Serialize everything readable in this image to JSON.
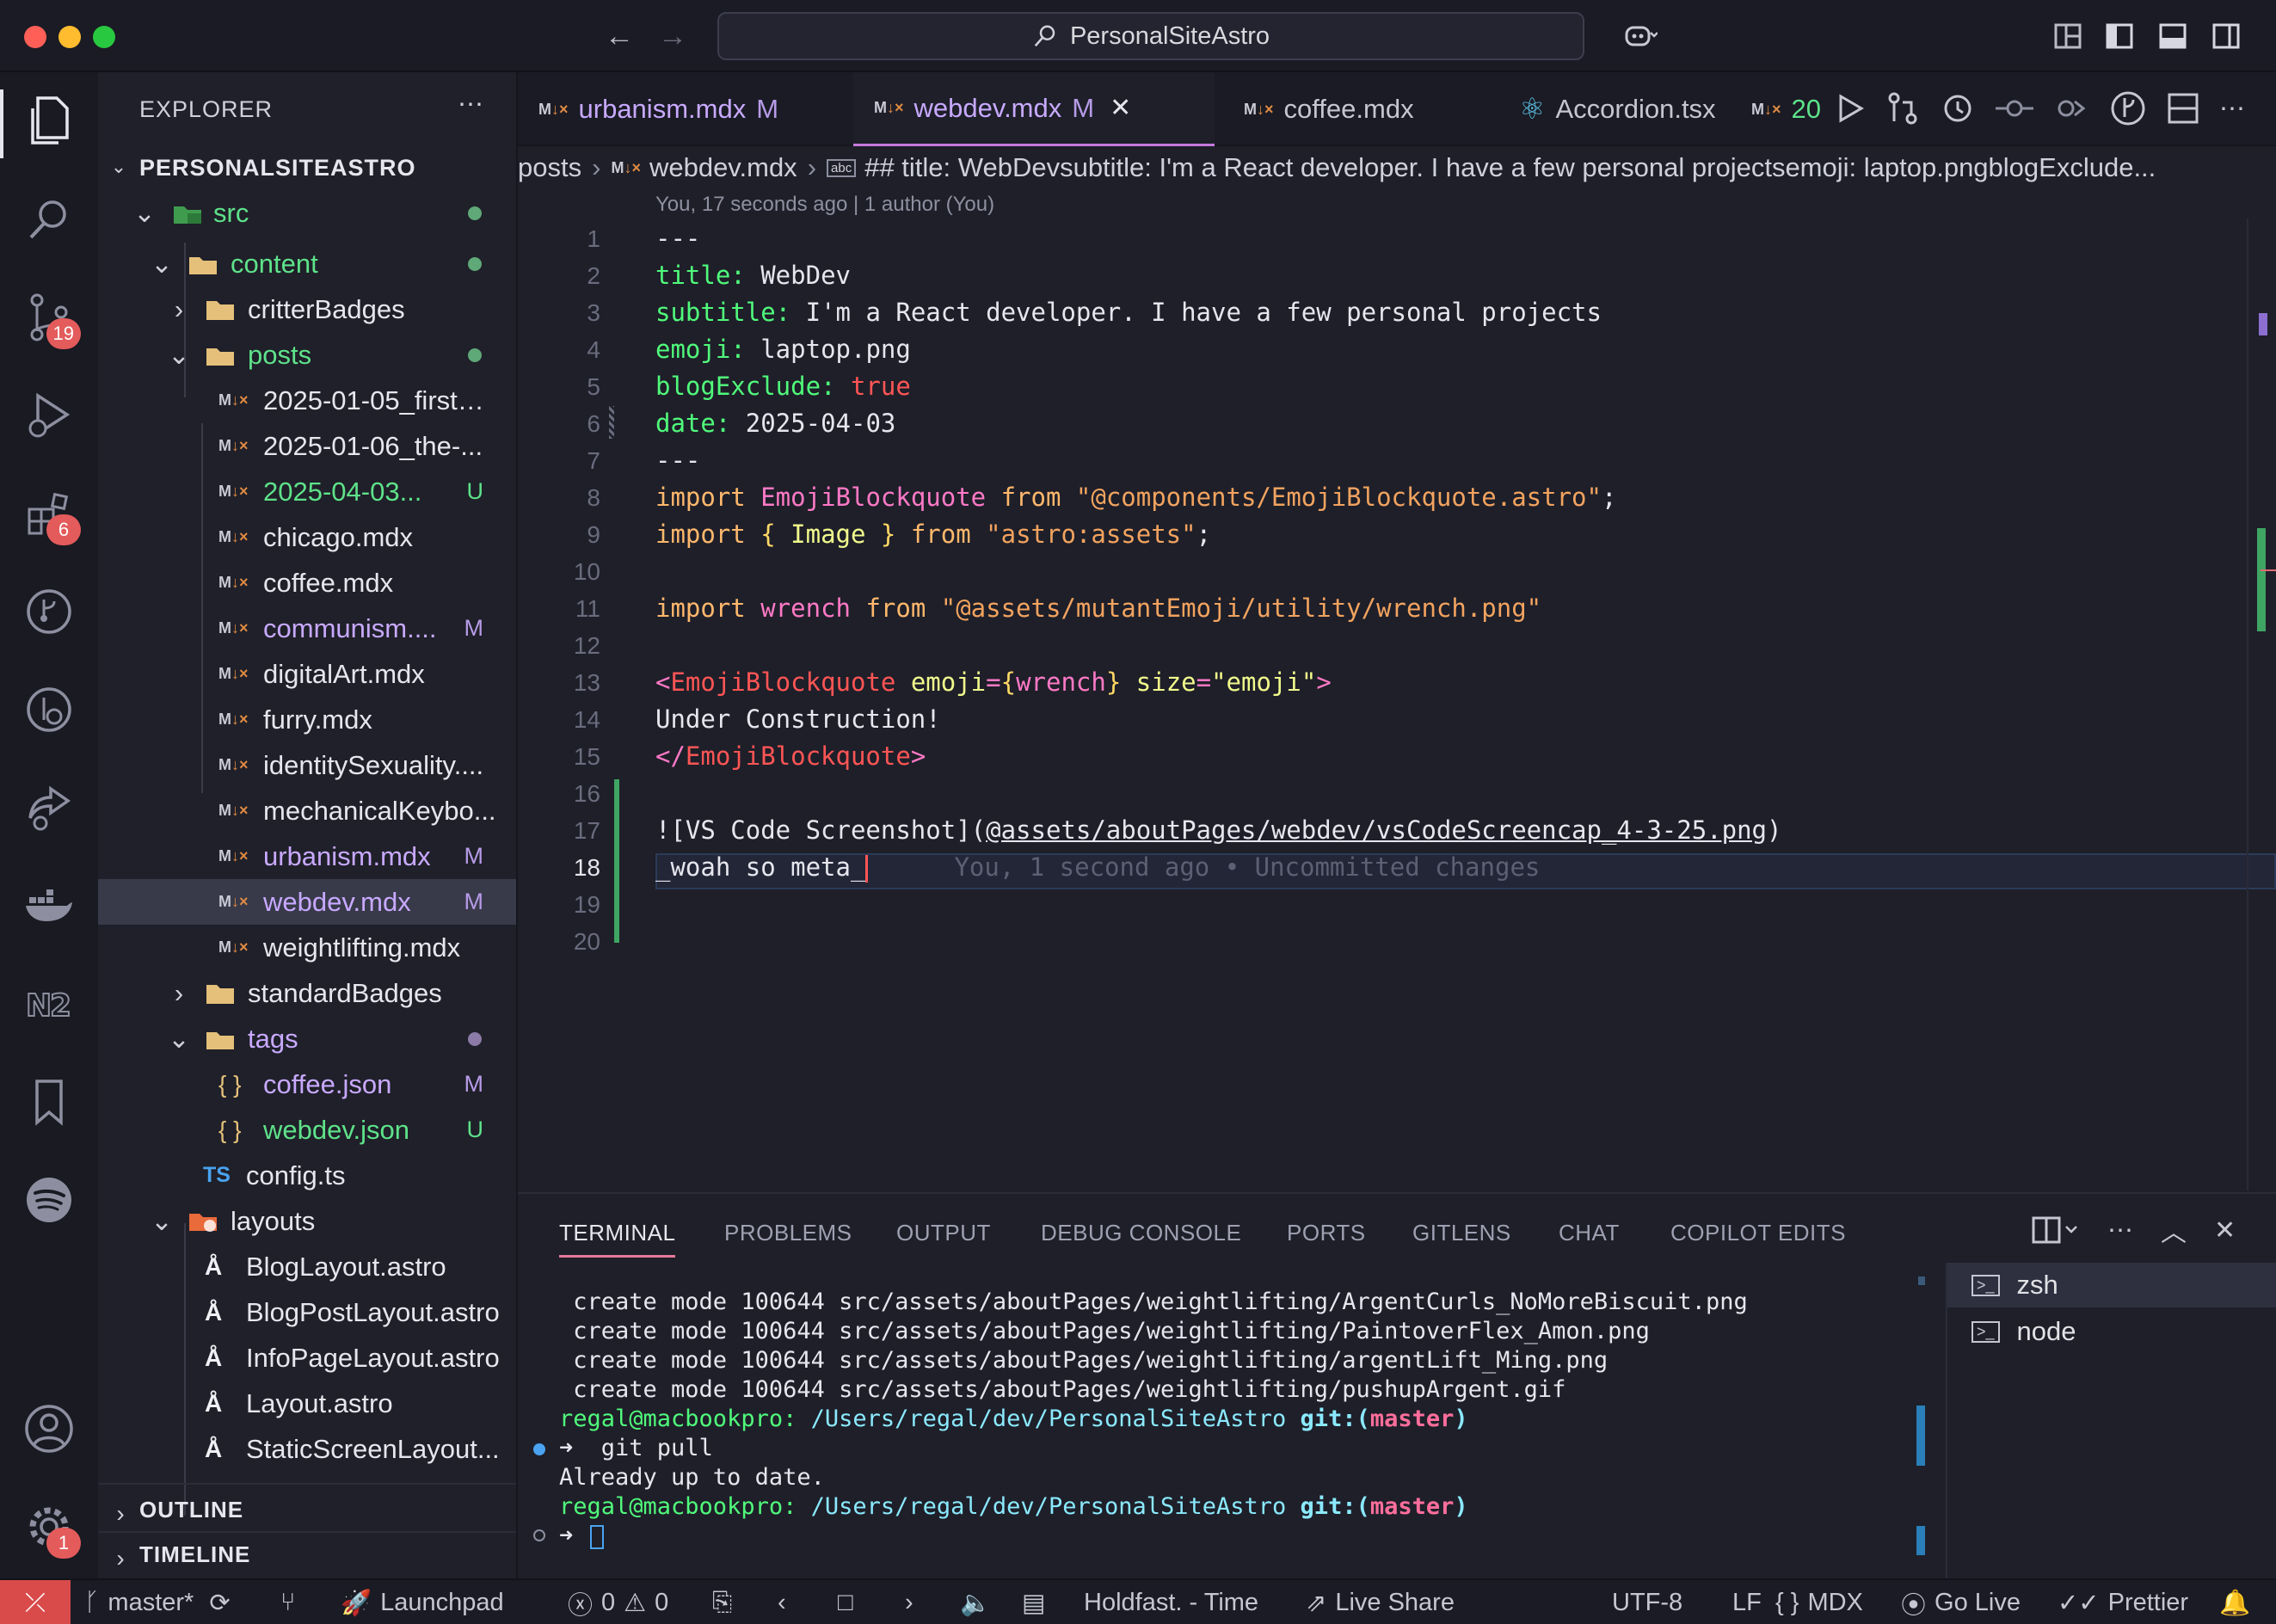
{
  "window": {
    "title": "PersonalSiteAstro"
  },
  "activity": {
    "scm_badge": "19",
    "ext_badge": "6",
    "settings_badge": "1"
  },
  "explorer": {
    "title": "EXPLORER",
    "project": "PERSONALSITEASTRO",
    "outline": "OUTLINE",
    "timeline": "TIMELINE",
    "items": [
      {
        "label": "src",
        "status": ""
      },
      {
        "label": "content",
        "status": ""
      },
      {
        "label": "critterBadges",
        "status": ""
      },
      {
        "label": "posts",
        "status": ""
      },
      {
        "label": "2025-01-05_first-...",
        "status": ""
      },
      {
        "label": "2025-01-06_the-...",
        "status": ""
      },
      {
        "label": "2025-04-03...",
        "status": "U"
      },
      {
        "label": "chicago.mdx",
        "status": ""
      },
      {
        "label": "coffee.mdx",
        "status": ""
      },
      {
        "label": "communism....",
        "status": "M"
      },
      {
        "label": "digitalArt.mdx",
        "status": ""
      },
      {
        "label": "furry.mdx",
        "status": ""
      },
      {
        "label": "identitySexuality....",
        "status": ""
      },
      {
        "label": "mechanicalKeybo...",
        "status": ""
      },
      {
        "label": "urbanism.mdx",
        "status": "M"
      },
      {
        "label": "webdev.mdx",
        "status": "M"
      },
      {
        "label": "weightlifting.mdx",
        "status": ""
      },
      {
        "label": "standardBadges",
        "status": ""
      },
      {
        "label": "tags",
        "status": ""
      },
      {
        "label": "coffee.json",
        "status": "M"
      },
      {
        "label": "webdev.json",
        "status": "U"
      },
      {
        "label": "config.ts",
        "status": ""
      },
      {
        "label": "layouts",
        "status": ""
      },
      {
        "label": "BlogLayout.astro",
        "status": ""
      },
      {
        "label": "BlogPostLayout.astro",
        "status": ""
      },
      {
        "label": "InfoPageLayout.astro",
        "status": ""
      },
      {
        "label": "Layout.astro",
        "status": ""
      },
      {
        "label": "StaticScreenLayout...",
        "status": ""
      }
    ]
  },
  "tabs": [
    {
      "label": "urbanism.mdx",
      "status": "M"
    },
    {
      "label": "webdev.mdx",
      "status": "M"
    },
    {
      "label": "coffee.mdx",
      "status": ""
    },
    {
      "label": "Accordion.tsx",
      "status": ""
    },
    {
      "label": "20",
      "status": ""
    }
  ],
  "breadcrumb": {
    "part1": "posts",
    "part2": "webdev.mdx",
    "part3": "## title: WebDevsubtitle: I'm a React developer. I have a few personal projectsemoji: laptop.pngblogExclude..."
  },
  "editor": {
    "blame": "You, 17 seconds ago | 1 author (You)",
    "line_numbers": [
      "1",
      "2",
      "3",
      "4",
      "5",
      "6",
      "7",
      "8",
      "9",
      "10",
      "11",
      "12",
      "13",
      "14",
      "15",
      "16",
      "17",
      "18",
      "19",
      "20"
    ],
    "l1": "---",
    "l2_key": "title:",
    "l2_val": " WebDev",
    "l3_key": "subtitle:",
    "l3_val": " I'm a React developer. I have a few personal projects",
    "l4_key": "emoji:",
    "l4_val": " laptop.png",
    "l5_key": "blogExclude:",
    "l5_val": " true",
    "l6_key": "date:",
    "l6_val": " 2025-04-03",
    "l7": "---",
    "l8_import": "import",
    "l8_name": " EmojiBlockquote",
    "l8_from": " from",
    "l8_path": " \"@components/EmojiBlockquote.astro\"",
    "l8_semi": ";",
    "l9_import": "import",
    "l9_open": " {",
    "l9_name": " Image",
    "l9_close": " }",
    "l9_from": " from",
    "l9_path": " \"astro:assets\"",
    "l9_semi": ";",
    "l11_import": "import",
    "l11_name": " wrench",
    "l11_from": " from",
    "l11_path": " \"@assets/mutantEmoji/utility/wrench.png\"",
    "l13_lt": "<",
    "l13_tag": "EmojiBlockquote",
    "l13_attr1": " emoji",
    "l13_eq1": "=",
    "l13_b1": "{",
    "l13_val1": "wrench",
    "l13_b2": "}",
    "l13_attr2": " size",
    "l13_eq2": "=",
    "l13_val2": "\"emoji\"",
    "l13_gt": ">",
    "l14": "Under Construction!",
    "l15_lt": "</",
    "l15_tag": "EmojiBlockquote",
    "l15_gt": ">",
    "l17_a": "![VS Code Screenshot](",
    "l17_path": "@assets/aboutPages/webdev/vsCodeScreencap_4-3-25.png",
    "l17_b": ")",
    "l18": "_woah so meta_",
    "l18_ghost": "You, 1 second ago • Uncommitted changes"
  },
  "panel": {
    "tabs": [
      "TERMINAL",
      "PROBLEMS",
      "OUTPUT",
      "DEBUG CONSOLE",
      "PORTS",
      "GITLENS",
      "CHAT",
      "COPILOT EDITS"
    ],
    "terminal": {
      "t1": " create mode 100644 src/assets/aboutPages/weightlifting/ArgentCurls_NoMoreBiscuit.png",
      "t2": " create mode 100644 src/assets/aboutPages/weightlifting/PaintoverFlex_Amon.png",
      "t3": " create mode 100644 src/assets/aboutPages/weightlifting/argentLift_Ming.png",
      "t4": " create mode 100644 src/assets/aboutPages/weightlifting/pushupArgent.gif",
      "prompt_user": "regal@macbookpro:",
      "prompt_path": " /Users/regal/dev/PersonalSiteAstro",
      "prompt_git": " git:",
      "prompt_po": "(",
      "prompt_branch": "master",
      "prompt_pc": ")",
      "arrow": "➜",
      "cmd": "  git pull",
      "out": "Already up to date."
    },
    "terminals": [
      "zsh",
      "node"
    ]
  },
  "statusbar": {
    "branch": "master*",
    "launchpad": "Launchpad",
    "errors": "0",
    "warnings": "0",
    "track": "Holdfast. - Time",
    "liveshare": "Live Share",
    "encoding": "UTF-8",
    "eol": "LF",
    "language": "MDX",
    "golive": "Go Live",
    "prettier": "Prettier"
  },
  "colors": {
    "accent": "#c678dd",
    "added": "#50fa7b",
    "modified": "#c8a9ff",
    "untracked": "#58e08a"
  }
}
